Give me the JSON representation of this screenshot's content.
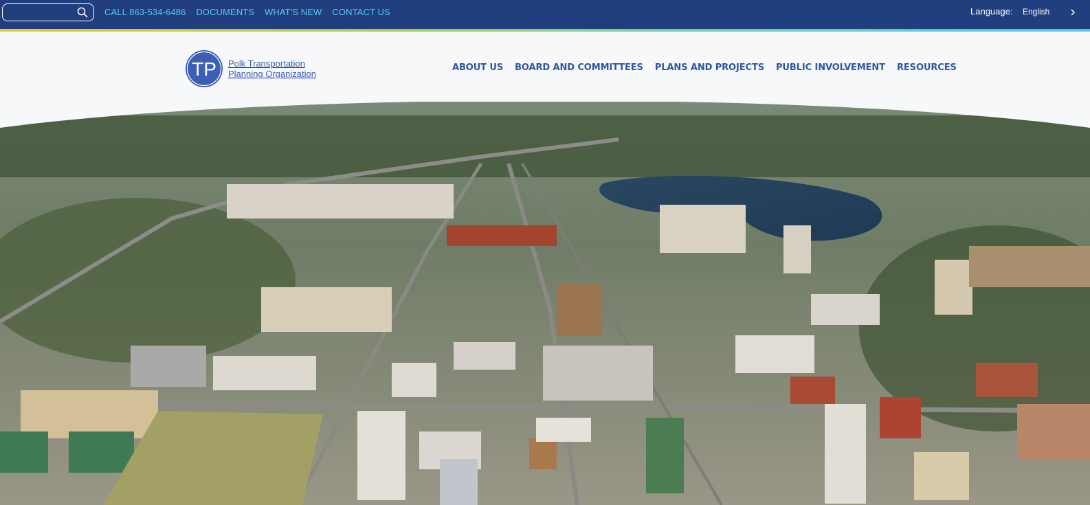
{
  "topbar": {
    "search": {
      "value": "",
      "placeholder": ""
    },
    "links": [
      {
        "label": "CALL 863-534-6486"
      },
      {
        "label": "DOCUMENTS"
      },
      {
        "label": "WHAT'S NEW"
      },
      {
        "label": "CONTACT US"
      }
    ],
    "language": {
      "label": "Language:",
      "selected": "English"
    }
  },
  "header": {
    "logo": {
      "monogram": "TP",
      "line1": "Polk Transportation",
      "line2": "Planning Organization"
    },
    "nav": [
      {
        "label": "ABOUT US"
      },
      {
        "label": "BOARD AND COMMITTEES"
      },
      {
        "label": "PLANS AND PROJECTS"
      },
      {
        "label": "PUBLIC INVOLVEMENT"
      },
      {
        "label": "RESOURCES"
      }
    ]
  },
  "colors": {
    "topbar_bg": "#213f7e",
    "utility_link": "#57c8f0",
    "nav_text": "#2e56a6",
    "logo_blue": "#3a5fb4",
    "header_bg": "#f7f8f9"
  },
  "icons": {
    "search": "search-icon",
    "language_toggle": "chevron-right-icon",
    "logo": "tpo-logo-icon"
  },
  "hero": {
    "subject": "aerial-city-photo"
  }
}
